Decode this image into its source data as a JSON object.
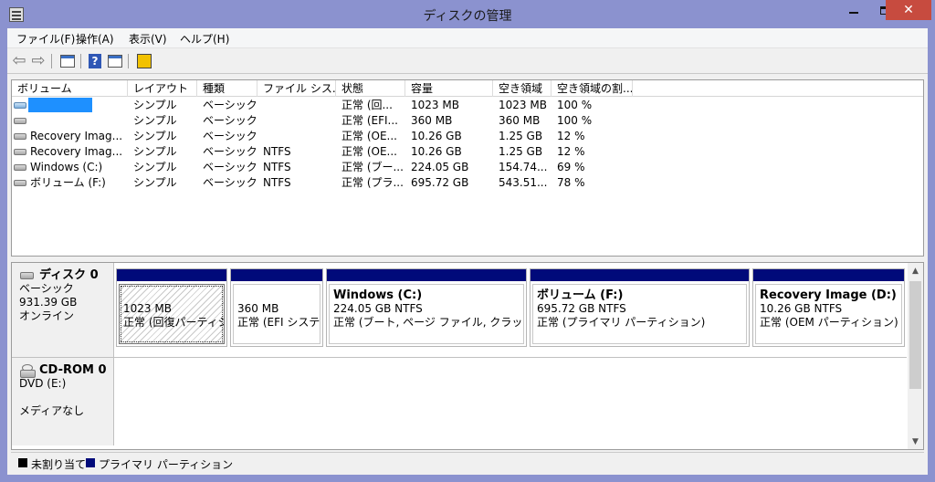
{
  "window": {
    "title": "ディスクの管理",
    "close_glyph": "✕"
  },
  "menu": [
    "ファイル(F)",
    "操作(A)",
    "表示(V)",
    "ヘルプ(H)"
  ],
  "toolbar": {
    "icons": [
      "back-arrow-icon",
      "forward-arrow-icon",
      "show-hide-console-tree-icon",
      "help-icon",
      "properties-pane-icon",
      "disk-properties-icon"
    ],
    "help_glyph": "?"
  },
  "volume_table": {
    "columns": [
      "ボリューム",
      "レイアウト",
      "種類",
      "ファイル シス...",
      "状態",
      "容量",
      "空き領域",
      "空き領域の割..."
    ],
    "rows": [
      {
        "volume": "",
        "layout": "シンプル",
        "type": "ベーシック",
        "fs": "",
        "status": "正常 (回...",
        "capacity": "1023 MB",
        "free": "1023 MB",
        "pct": "100 %",
        "highlight": true
      },
      {
        "volume": "",
        "layout": "シンプル",
        "type": "ベーシック",
        "fs": "",
        "status": "正常 (EFI...",
        "capacity": "360 MB",
        "free": "360 MB",
        "pct": "100 %"
      },
      {
        "volume": "Recovery Imag...",
        "layout": "シンプル",
        "type": "ベーシック",
        "fs": "",
        "status": "正常 (OE...",
        "capacity": "10.26 GB",
        "free": "1.25 GB",
        "pct": "12 %"
      },
      {
        "volume": "Recovery Imag...",
        "layout": "シンプル",
        "type": "ベーシック",
        "fs": "NTFS",
        "status": "正常 (OE...",
        "capacity": "10.26 GB",
        "free": "1.25 GB",
        "pct": "12 %"
      },
      {
        "volume": "Windows (C:)",
        "layout": "シンプル",
        "type": "ベーシック",
        "fs": "NTFS",
        "status": "正常 (ブー...",
        "capacity": "224.05 GB",
        "free": "154.74...",
        "pct": "69 %"
      },
      {
        "volume": "ボリューム (F:)",
        "layout": "シンプル",
        "type": "ベーシック",
        "fs": "NTFS",
        "status": "正常 (プラ...",
        "capacity": "695.72 GB",
        "free": "543.51...",
        "pct": "78 %"
      }
    ]
  },
  "disks": [
    {
      "name": "ディスク 0",
      "kind": "ベーシック",
      "size": "931.39 GB",
      "state": "オンライン",
      "partitions": [
        {
          "name": "",
          "size": "1023 MB",
          "status": "正常 (回復パーティショ",
          "selected": true
        },
        {
          "name": "",
          "size": "360 MB",
          "status": "正常 (EFI システム"
        },
        {
          "name": "Windows (C:)",
          "size": "224.05 GB NTFS",
          "status": "正常 (ブート, ページ ファイル, クラッシュ ダン"
        },
        {
          "name": "ボリューム (F:)",
          "size": "695.72 GB NTFS",
          "status": "正常 (プライマリ パーティション)"
        },
        {
          "name": "Recovery Image (D:)",
          "size": "10.26 GB NTFS",
          "status": "正常 (OEM パーティション)"
        }
      ]
    },
    {
      "name": "CD-ROM 0",
      "kind": "DVD (E:)",
      "media": "メディアなし"
    }
  ],
  "legend": [
    {
      "label": "未割り当て",
      "color": "#000000"
    },
    {
      "label": "プライマリ パーティション",
      "color": "#000a7a"
    }
  ],
  "scrollbar": {
    "up": "▲",
    "down": "▼"
  }
}
